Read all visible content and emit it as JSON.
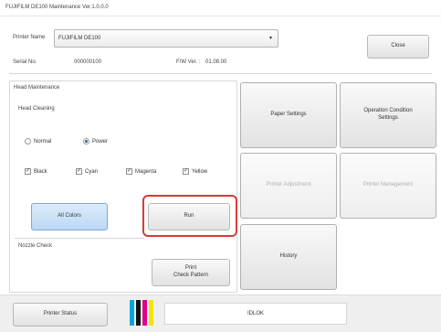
{
  "window": {
    "title": "FUJIFILM DE100 Maintenance Ver.1.0.0.0"
  },
  "header": {
    "printer_name_label": "Printer Name",
    "printer_name_value": "FUJIFILM DE100",
    "serial_label": "Serial No.",
    "serial_value": "000000100",
    "fw_label": "F/W Ver. :",
    "fw_value": "01.08.00",
    "close_label": "Close"
  },
  "head_maintenance": {
    "group_label": "Head Maintenance",
    "head_cleaning_label": "Head Cleaning",
    "modes": [
      {
        "label": "Normal",
        "selected": false
      },
      {
        "label": "Power",
        "selected": true
      }
    ],
    "colors": [
      {
        "label": "Black",
        "checked": true
      },
      {
        "label": "Cyan",
        "checked": true
      },
      {
        "label": "Magenta",
        "checked": true
      },
      {
        "label": "Yellow",
        "checked": true
      }
    ],
    "all_colors_label": "All Colors",
    "run_label": "Run",
    "nozzle_check_label": "Nozzle Check",
    "print_check_pattern_label": "Print\nCheck Pattern"
  },
  "right_panel": {
    "paper_settings": "Paper Settings",
    "operation_condition_settings": "Operation Condition\nSettings",
    "printer_adjustment": "Printer Adjustment",
    "printer_management": "Printer Management",
    "history": "History"
  },
  "status": {
    "printer_status_label": "Printer Status",
    "message": "IDLOK",
    "ink_colors": [
      "#00a6e0",
      "#111111",
      "#e0008a",
      "#f5e400"
    ]
  }
}
